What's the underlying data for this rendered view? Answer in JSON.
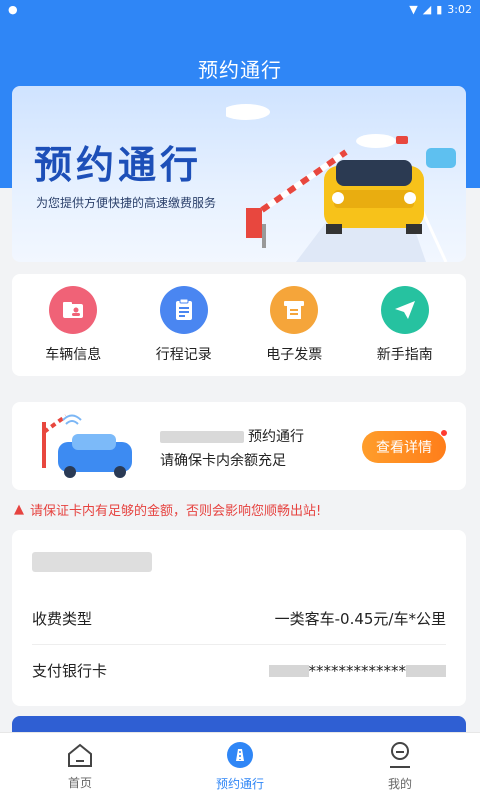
{
  "status": {
    "time": "3:02"
  },
  "header": {
    "title": "预约通行"
  },
  "banner": {
    "title": "预约通行",
    "subtitle": "为您提供方便快捷的高速缴费服务"
  },
  "quick_actions": [
    {
      "label": "车辆信息",
      "icon": "vehicle-info-icon",
      "color": "#f06277"
    },
    {
      "label": "行程记录",
      "icon": "trip-record-icon",
      "color": "#4a86f1"
    },
    {
      "label": "电子发票",
      "icon": "e-invoice-icon",
      "color": "#f5a53a"
    },
    {
      "label": "新手指南",
      "icon": "guide-icon",
      "color": "#26c2a0"
    }
  ],
  "notice": {
    "line1_suffix": "预约通行",
    "line2": "请确保卡内余额充足",
    "detail_button": "查看详情"
  },
  "warning": {
    "text": "请保证卡内有足够的金额，否则会影响您顺畅出站!"
  },
  "info": {
    "rows": [
      {
        "label": "收费类型",
        "value": "一类客车-0.45元/车*公里"
      },
      {
        "label": "支付银行卡",
        "value": "*************"
      }
    ]
  },
  "tabs": [
    {
      "label": "首页",
      "icon": "home-icon"
    },
    {
      "label": "预约通行",
      "icon": "reservation-icon"
    },
    {
      "label": "我的",
      "icon": "profile-icon"
    }
  ],
  "colors": {
    "primary": "#2f86f6",
    "warning": "#e64340",
    "accent": "#ff8a20"
  }
}
